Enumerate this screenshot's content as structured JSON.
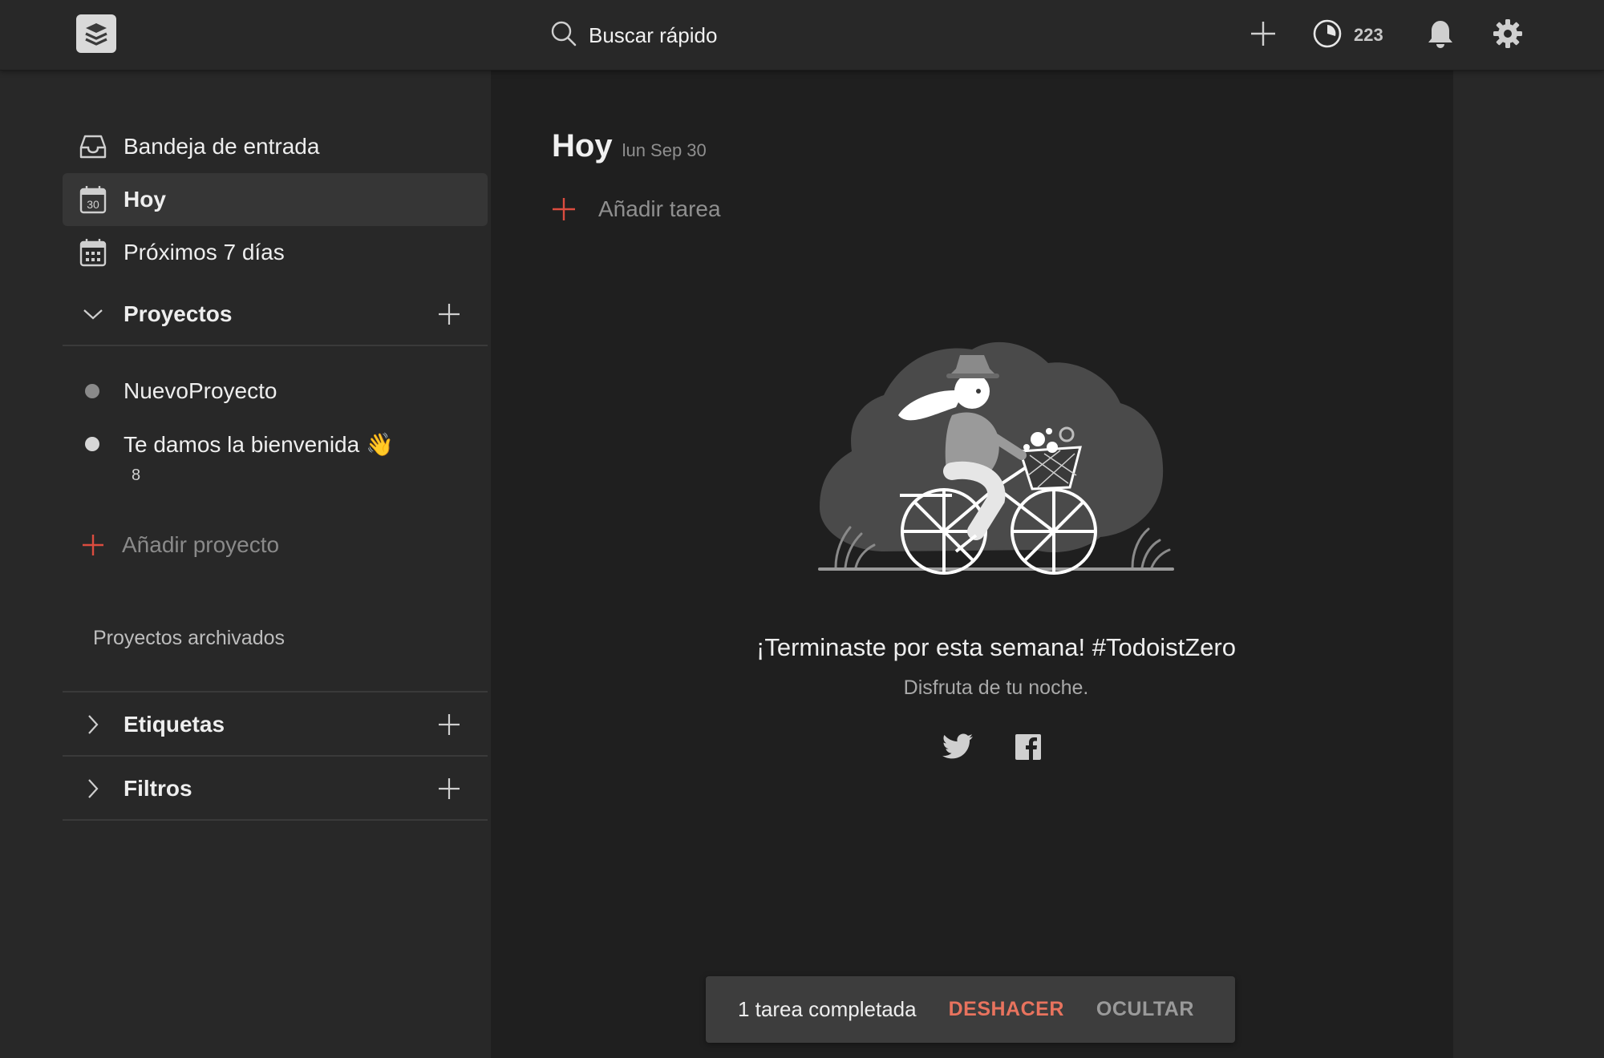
{
  "topbar": {
    "logo_icon": "todoist-logo-icon",
    "search_label": "Buscar rápido",
    "search_icon": "search-icon",
    "add_icon": "plus-icon",
    "karma_icon": "karma-pie-icon",
    "karma_value": "223",
    "notifications_icon": "bell-icon",
    "settings_icon": "gear-icon"
  },
  "sidebar": {
    "items": [
      {
        "label": "Bandeja de entrada",
        "icon": "inbox-icon"
      },
      {
        "label": "Hoy",
        "icon": "calendar-today-icon",
        "day": "30",
        "active": true
      },
      {
        "label": "Próximos 7 días",
        "icon": "calendar-week-icon"
      }
    ],
    "projects": {
      "title": "Proyectos",
      "items": [
        {
          "label": "NuevoProyecto",
          "color": "#8a8a8a"
        },
        {
          "label": "Te damos la bienvenida 👋",
          "color": "#d6d6d6",
          "count": "8"
        }
      ],
      "add_label": "Añadir proyecto",
      "archived_label": "Proyectos archivados"
    },
    "labels_title": "Etiquetas",
    "filters_title": "Filtros"
  },
  "main": {
    "title": "Hoy",
    "date": "lun Sep 30",
    "add_task_label": "Añadir tarea",
    "empty_title": "¡Terminaste por esta semana! #TodoistZero",
    "empty_subtitle": "Disfruta de tu noche.",
    "share_icons": [
      "twitter-icon",
      "facebook-icon"
    ]
  },
  "toast": {
    "message": "1 tarea completada",
    "undo_label": "DESHACER",
    "hide_label": "OCULTAR"
  },
  "colors": {
    "accent": "#db4c3f",
    "undo": "#e8735e",
    "background": "#1f1f1f",
    "sidebar": "#282828"
  }
}
